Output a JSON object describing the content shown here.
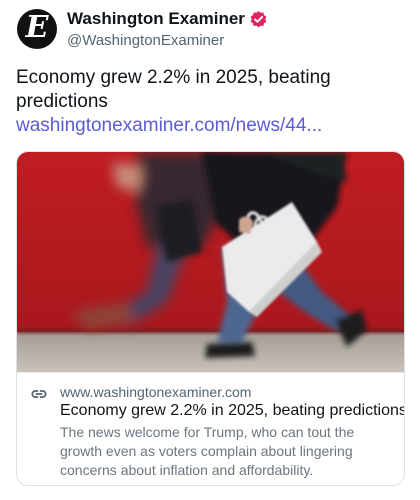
{
  "account": {
    "display_name": "Washington Examiner",
    "handle": "@WashingtonExaminer",
    "avatar_letter": "E",
    "verified_color": "#e0245e"
  },
  "post": {
    "text": "Economy grew 2.2% in 2025, beating predictions ",
    "link_text": "washingtonexaminer.com/news/44..."
  },
  "card": {
    "image": "photo-pedestrian-shopping-bag",
    "link_icon": "link-icon",
    "domain": "www.washingtonexaminer.com",
    "title": "Economy grew 2.2% in 2025, beating predictions",
    "description": "The news welcome for Trump, who can tout the growth even as voters complain about lingering concerns about inflation and affordability."
  },
  "colors": {
    "link": "#5b5bd6",
    "secondary_text": "#536471",
    "wall_red": "#b51a1f"
  }
}
